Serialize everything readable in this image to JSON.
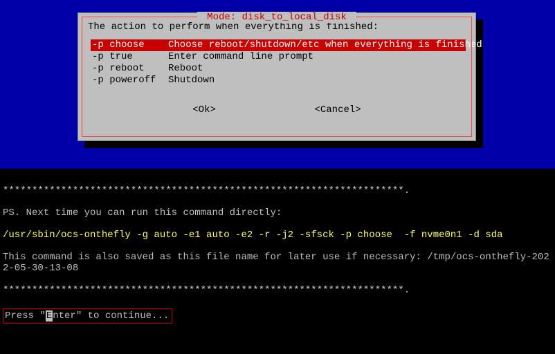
{
  "dialog": {
    "title": " Mode: disk_to_local_disk ",
    "prompt": "The action to perform when everything is finished:",
    "options": [
      {
        "key": "-p choose",
        "desc": "Choose reboot/shutdown/etc when everything is finished",
        "selected": true
      },
      {
        "key": "-p true",
        "desc": "Enter command line prompt",
        "selected": false
      },
      {
        "key": "-p reboot",
        "desc": "Reboot",
        "selected": false
      },
      {
        "key": "-p poweroff",
        "desc": "Shutdown",
        "selected": false
      }
    ],
    "buttons": {
      "ok": "<Ok>",
      "cancel": "<Cancel>"
    }
  },
  "terminal": {
    "sep_top": "*********************************************************************.",
    "ps_line": "PS. Next time you can run this command directly:",
    "cmd": "/usr/sbin/ocs-onthefly -g auto -e1 auto -e2 -r -j2 -sfsck -p choose  -f nvme0n1 -d sda",
    "saved": "This command is also saved as this file name for later use if necessary: /tmp/ocs-onthefly-2022-05-30-13-08",
    "sep_bottom": "*********************************************************************.",
    "press_pre": "Press \"",
    "press_cursor": "E",
    "press_post": "nter\" to continue..."
  }
}
